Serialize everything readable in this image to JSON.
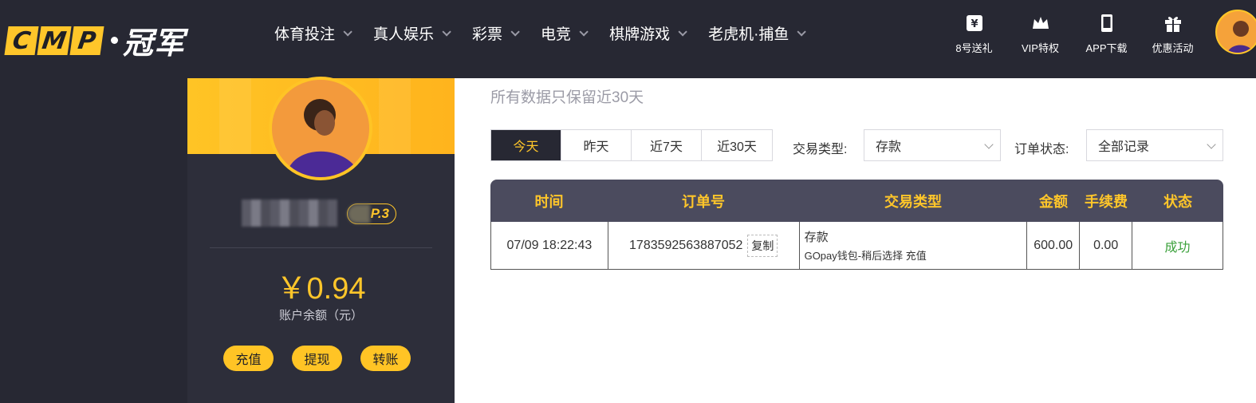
{
  "logo": {
    "letters": [
      "C",
      "M",
      "P"
    ],
    "cn": "冠军"
  },
  "nav": [
    {
      "label": "体育投注"
    },
    {
      "label": "真人娱乐"
    },
    {
      "label": "彩票"
    },
    {
      "label": "电竞"
    },
    {
      "label": "棋牌游戏"
    },
    {
      "label": "老虎机·捕鱼"
    }
  ],
  "top_actions": [
    {
      "label": "8号送礼",
      "icon": "gift-card-icon"
    },
    {
      "label": "VIP特权",
      "icon": "crown-icon"
    },
    {
      "label": "APP下载",
      "icon": "phone-icon"
    },
    {
      "label": "优惠活动",
      "icon": "gift-box-icon"
    }
  ],
  "profile": {
    "vip_label": "P.3",
    "balance": "￥0.94",
    "balance_label": "账户余额（元）",
    "buttons": [
      "充值",
      "提现",
      "转账"
    ]
  },
  "main": {
    "note": "所有数据只保留近30天",
    "ranges": [
      "今天",
      "昨天",
      "近7天",
      "近30天"
    ],
    "active_range": "今天",
    "type_label": "交易类型:",
    "type_value": "存款",
    "status_label": "订单状态:",
    "status_value": "全部记录"
  },
  "table": {
    "headers": [
      "时间",
      "订单号",
      "交易类型",
      "金额",
      "手续费",
      "状态"
    ],
    "rows": [
      {
        "time": "07/09 18:22:43",
        "order": "1783592563887052",
        "copy": "复制",
        "type_main": "存款",
        "type_sub": "GOpay钱包-稍后选择 充值",
        "amount": "600.00",
        "fee": "0.00",
        "status": "成功"
      }
    ]
  },
  "colors": {
    "accent": "#ffc62a",
    "dark": "#272833",
    "success": "#3aa03a"
  }
}
